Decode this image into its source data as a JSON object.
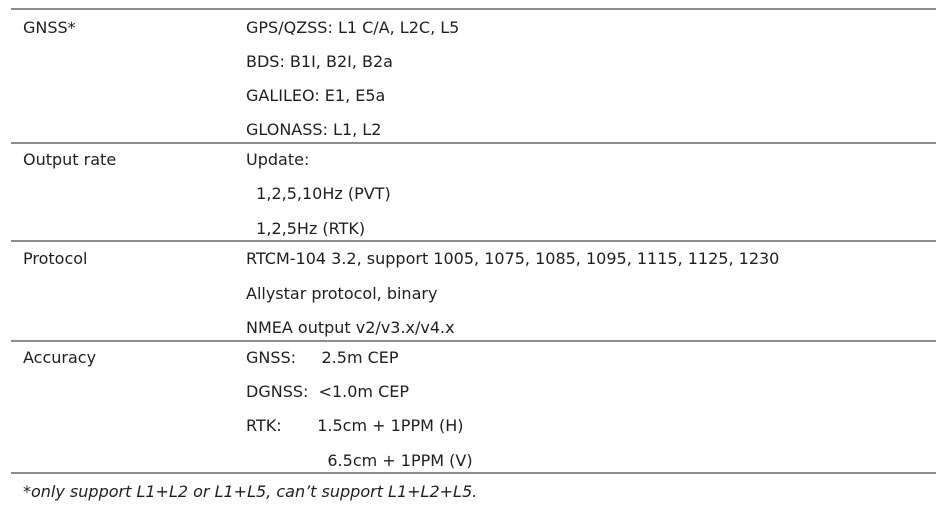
{
  "rows": [
    {
      "label": "GNSS*",
      "lines": [
        "GPS/QZSS: L1 C/A, L2C, L5",
        "BDS: B1I, B2I, B2a",
        "GALILEO: E1, E5a",
        "GLONASS: L1, L2"
      ]
    },
    {
      "label": "Output rate",
      "lines": [
        "Update:",
        "  1,2,5,10Hz (PVT)",
        "  1,2,5Hz (RTK)"
      ]
    },
    {
      "label": "Protocol",
      "lines": [
        "RTCM-104 3.2, support 1005, 1075, 1085, 1095, 1115, 1125, 1230",
        "Allystar protocol, binary",
        "NMEA output v2/v3.x/v4.x"
      ]
    },
    {
      "label": "Accuracy",
      "lines": [
        "GNSS:     2.5m CEP",
        "DGNSS:  <1.0m CEP",
        "RTK:       1.5cm + 1PPM (H)",
        "                6.5cm + 1PPM (V)"
      ]
    }
  ],
  "footnote": "*only support L1+L2 or L1+L5, can’t support L1+L2+L5."
}
